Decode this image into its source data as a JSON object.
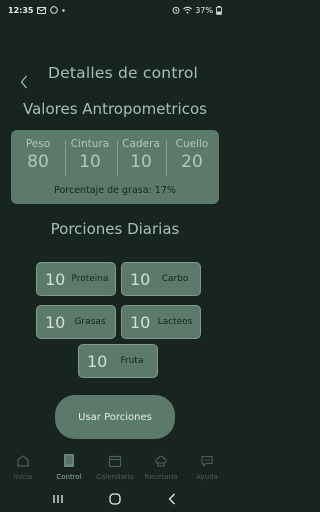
{
  "status_bar": {
    "time": "12:35",
    "battery": "37%",
    "icons": [
      "email-icon",
      "whatsapp-icon",
      "dot-icon",
      "alarm-icon",
      "wifi-icon",
      "battery-icon"
    ]
  },
  "header": {
    "title": "Detalles de control",
    "back_icon": "chevron-left-icon"
  },
  "anthropometric": {
    "title": "Valores Antropometricos",
    "measures": [
      {
        "label": "Peso",
        "value": "80"
      },
      {
        "label": "Cintura",
        "value": "10"
      },
      {
        "label": "Cadera",
        "value": "10"
      },
      {
        "label": "Cuello",
        "value": "20"
      }
    ],
    "fat_percentage": "Porcentaje de grasa: 17%"
  },
  "portions": {
    "title": "Porciones Diarias",
    "items": [
      {
        "count": "10",
        "name": "Proteina"
      },
      {
        "count": "10",
        "name": "Carbo"
      },
      {
        "count": "10",
        "name": "Grasas"
      },
      {
        "count": "10",
        "name": "Lacteos"
      },
      {
        "count": "10",
        "name": "Fruta"
      }
    ]
  },
  "use_button": "Usar Porciones",
  "nav": {
    "items": [
      {
        "label": "Inicio",
        "icon": "home-icon"
      },
      {
        "label": "Control",
        "icon": "book-icon",
        "active": true
      },
      {
        "label": "Calendario",
        "icon": "calendar-icon"
      },
      {
        "label": "Recetario",
        "icon": "chef-hat-icon"
      },
      {
        "label": "Ayuda",
        "icon": "chat-icon"
      }
    ]
  },
  "system_nav": [
    "recent-apps-icon",
    "home-circle-icon",
    "back-icon"
  ],
  "colors": {
    "background": "#182420",
    "card": "#5c7a6b",
    "text_accent": "#a3c0b1"
  }
}
